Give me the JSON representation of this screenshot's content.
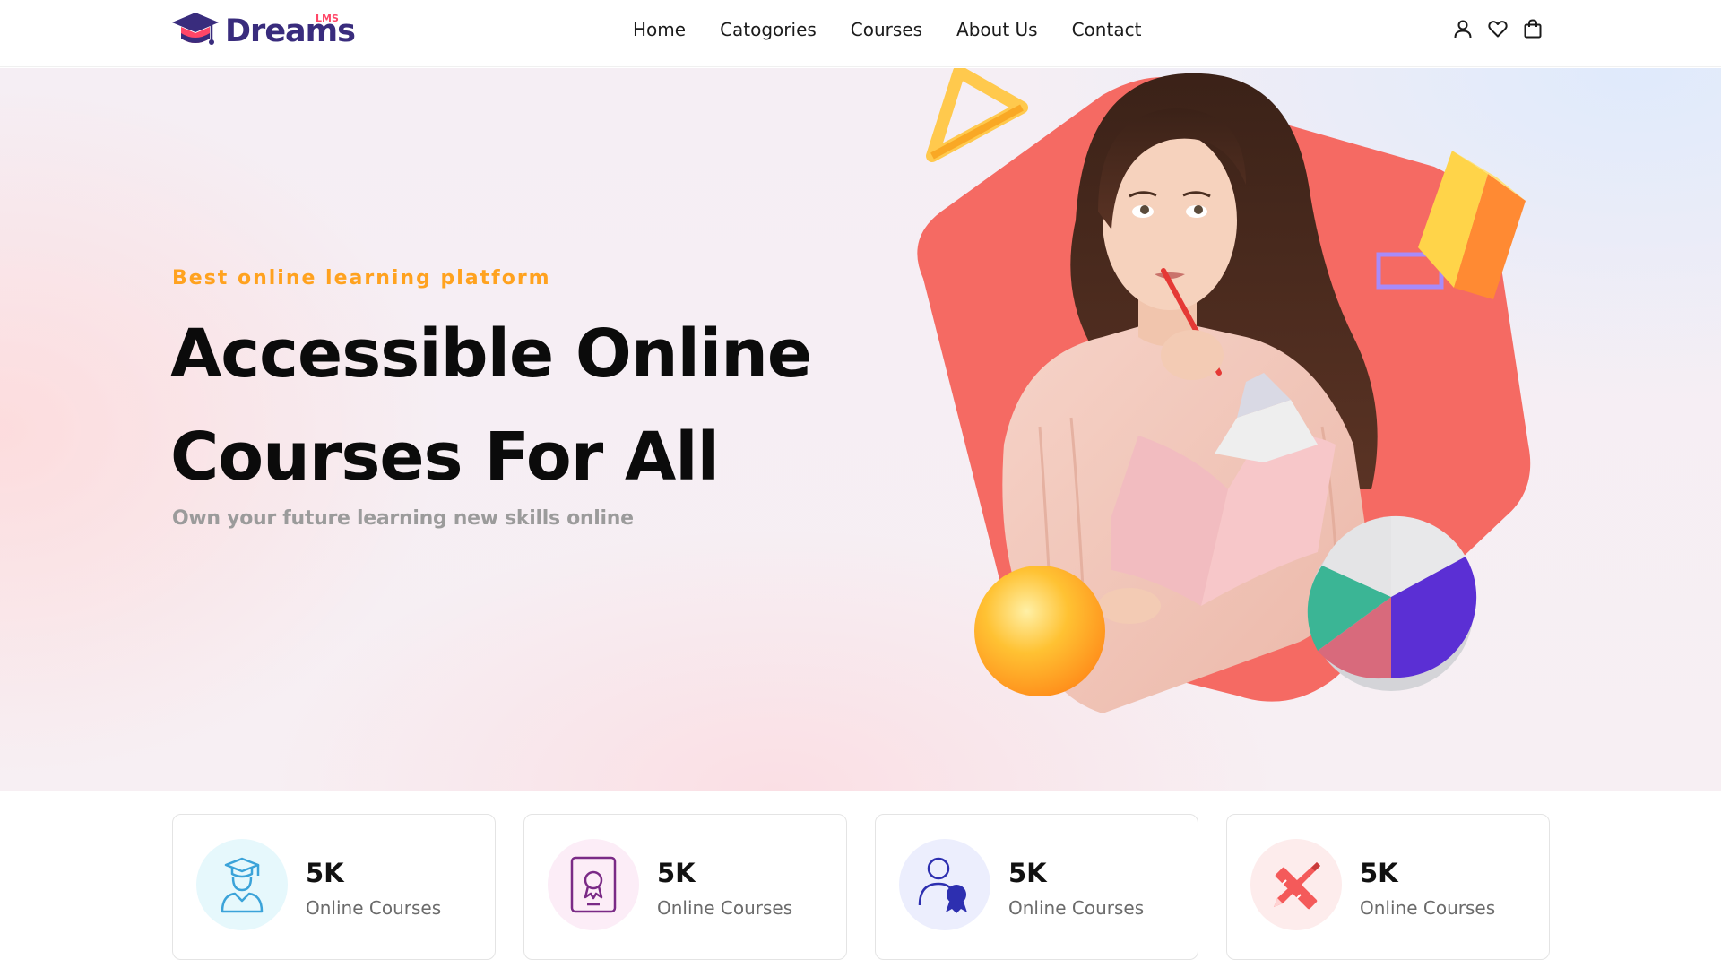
{
  "header": {
    "logo": {
      "name": "Dreams",
      "superscript": "LMS",
      "icon": "graduation-cap-icon",
      "brand_color": "#392c7d",
      "accent_color": "#ff4667"
    },
    "nav": [
      "Home",
      "Catogories",
      "Courses",
      "About Us",
      "Contact"
    ],
    "icons": [
      "user-icon",
      "heart-icon",
      "shopping-bag-icon"
    ]
  },
  "hero": {
    "tagline": "Best online learning platform",
    "title_line1": "Accessible Online",
    "title_line2": "Courses For All",
    "subtitle": "Own your future learning new skills online",
    "image": "woman-holding-book-with-pencil",
    "colors": {
      "tagline": "#ffa21f",
      "shape": "#f56a63"
    }
  },
  "stats": [
    {
      "value": "5K",
      "label": "Online Courses",
      "icon": "graduate-student-icon",
      "icon_bg": "#e6f8fc",
      "icon_color": "#3ba3d9"
    },
    {
      "value": "5K",
      "label": "Online Courses",
      "icon": "certificate-tablet-icon",
      "icon_bg": "#fcedf7",
      "icon_color": "#7a2a86"
    },
    {
      "value": "5K",
      "label": "Online Courses",
      "icon": "user-award-icon",
      "icon_bg": "#eceefd",
      "icon_color": "#2d2fb0"
    },
    {
      "value": "5K",
      "label": "Online Courses",
      "icon": "pencil-ruler-icon",
      "icon_bg": "#fdecec",
      "icon_color": "#f45a5a"
    }
  ]
}
